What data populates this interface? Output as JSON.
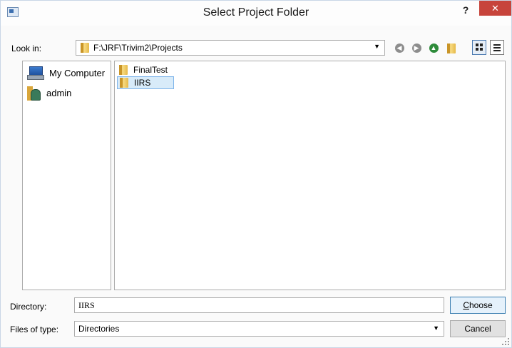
{
  "window": {
    "title": "Select Project Folder",
    "help_label": "?",
    "close_label": "✕"
  },
  "lookin": {
    "label": "Look in:",
    "path": "F:\\JRF\\Trivim2\\Projects",
    "dropdown_arrow": "▼"
  },
  "toolbar": {
    "back_icon": "back-icon",
    "forward_icon": "forward-icon",
    "up_icon": "up-icon",
    "new_folder_icon": "new-folder-icon",
    "list_view_icon": "list-view-icon",
    "detail_view_icon": "detail-view-icon"
  },
  "sidebar": {
    "items": [
      {
        "label": "My Computer",
        "icon": "computer-icon"
      },
      {
        "label": "admin",
        "icon": "user-folder-icon"
      }
    ]
  },
  "files": {
    "items": [
      {
        "label": "FinalTest",
        "icon": "folder-icon",
        "selected": false
      },
      {
        "label": "IIRS",
        "icon": "folder-icon",
        "selected": true
      }
    ]
  },
  "directory": {
    "label": "Directory:",
    "value": "IIRS"
  },
  "filetype": {
    "label": "Files of type:",
    "value": "Directories",
    "dropdown_arrow": "▼"
  },
  "buttons": {
    "choose_first": "C",
    "choose_rest": "hoose",
    "cancel": "Cancel"
  },
  "colors": {
    "close_bg": "#c7443b",
    "selection_bg": "#d8ebf9",
    "selection_border": "#7eb4ea",
    "accent": "#3c7fb1"
  }
}
